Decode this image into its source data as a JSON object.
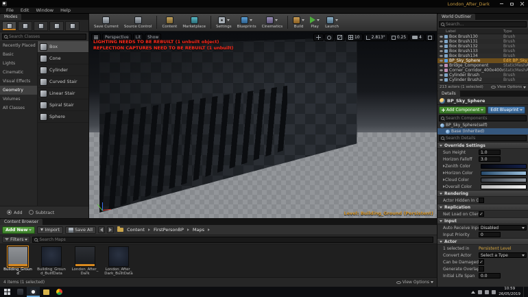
{
  "glyphs": {
    "check": "✓"
  },
  "window": {
    "title": "London_After_Dark",
    "menu": [
      "File",
      "Edit",
      "Window",
      "Help"
    ]
  },
  "modes": {
    "panel_title": "Modes",
    "search_placeholder": "Search Classes",
    "categories": [
      "Recently Placed",
      "Basic",
      "Lights",
      "Cinematic",
      "Visual Effects",
      "Geometry",
      "Volumes",
      "All Classes"
    ],
    "items": [
      "Box",
      "Cone",
      "Cylinder",
      "Curved Stair",
      "Linear Stair",
      "Spiral Stair",
      "Sphere"
    ],
    "add_label": "Add",
    "subtract_label": "Subtract"
  },
  "toolbar": {
    "buttons": [
      "Save Current",
      "Source Control",
      "Content",
      "Marketplace",
      "Settings",
      "Blueprints",
      "Cinematics",
      "Build",
      "Play",
      "Launch"
    ]
  },
  "viewport": {
    "warning1": "LIGHTING NEEDS TO BE REBUILT (1 unbuilt object)",
    "warning2": "REFLECTION CAPTURES NEED TO BE REBUILT (1 unbuilt)",
    "perspective_label": "Perspective",
    "lit_label": "Lit",
    "show_label": "Show",
    "grid_snap": "10",
    "rotation_snap": "2.813°",
    "scale_snap": "0.25",
    "camera_speed": "4",
    "level_label": "Level: Building_Ground (Persistent)"
  },
  "outliner": {
    "tab": "World Outliner",
    "search_placeholder": "Search...",
    "col_label": "Label",
    "col_type": "Type",
    "rows": [
      {
        "label": "Box Brush130",
        "type": "Brush"
      },
      {
        "label": "Box Brush131",
        "type": "Brush"
      },
      {
        "label": "Box Brush132",
        "type": "Brush"
      },
      {
        "label": "Box Brush133",
        "type": "Brush"
      },
      {
        "label": "Box Brush134",
        "type": "Brush"
      },
      {
        "label": "BP_Sky_Sphere",
        "type": "Edit BP_Sky_Sphere"
      },
      {
        "label": "Bridge_Component",
        "type": "StaticMeshActor"
      },
      {
        "label": "Corner_Corridor_400x400x300",
        "type": "StaticMeshActor"
      },
      {
        "label": "Cylinder Brush",
        "type": "Brush"
      },
      {
        "label": "Cylinder Brush2",
        "type": "Brush"
      }
    ],
    "status": "213 actors (1 selected)",
    "view_options": "View Options"
  },
  "details": {
    "tab": "Details",
    "actor_name": "BP_Sky_Sphere",
    "add_component": "Add Component",
    "edit_blueprint": "Edit Blueprint",
    "search_components": "Search Components",
    "component_self": "BP_Sky_Sphere(self)",
    "component_base": "Base (Inherited)",
    "search_details": "Search Details",
    "sec_override": "Override Settings",
    "sun_height": "Sun Height",
    "sun_height_v": "1.0",
    "horizon_falloff": "Horizon Falloff",
    "horizon_falloff_v": "3.0",
    "zenith_color": "Zenith Color",
    "horizon_color": "Horizon Color",
    "cloud_color": "Cloud Color",
    "overall_color": "Overall Color",
    "sec_rendering": "Rendering",
    "actor_hidden": "Actor Hidden In Ga",
    "sec_replication": "Replication",
    "net_load": "Net Load on Client",
    "sec_input": "Input",
    "auto_receive": "Auto Receive Input",
    "auto_receive_v": "Disabled",
    "input_priority": "Input Priority",
    "input_priority_v": "0",
    "sec_actor": "Actor",
    "selected_info": "1 selected in",
    "selected_level": "Persistent Level",
    "convert_actor": "Convert Actor",
    "convert_actor_v": "Select a Type",
    "can_damage": "Can be Damaged",
    "generate_overlap": "Generate Overlap E",
    "initial_life": "Initial Life Span",
    "initial_life_v": "0.0"
  },
  "content_browser": {
    "tab": "Content Browser",
    "add_new": "Add New",
    "import": "Import",
    "save_all": "Save All",
    "crumb_content": "Content",
    "crumb_project": "FirstPersonBP",
    "crumb_folder": "Maps",
    "filters": "Filters",
    "search_placeholder": "Search Maps",
    "assets": [
      {
        "name": "Building_Ground"
      },
      {
        "name": "Building_Ground_BuiltData"
      },
      {
        "name": "London_After_Dark"
      },
      {
        "name": "London_After_Dark_BuiltData"
      }
    ],
    "status": "4 items (1 selected)",
    "view_options": "View Options"
  },
  "taskbar": {
    "time": "10:59",
    "date": "26/05/2019"
  }
}
